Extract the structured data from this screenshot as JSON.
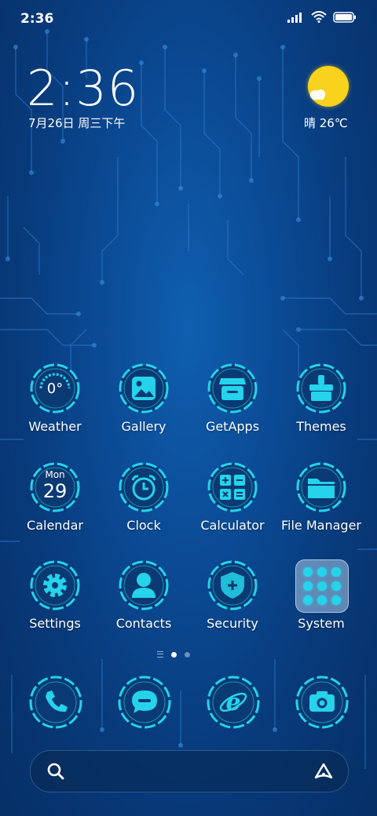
{
  "status_bar": {
    "time": "2:36"
  },
  "widget": {
    "time": "2:36",
    "date": "7月26日 周三下午",
    "weather": "晴 26℃"
  },
  "apps": [
    {
      "label": "Weather",
      "icon": "weather-icon",
      "glyph_text": "0°"
    },
    {
      "label": "Gallery",
      "icon": "gallery-icon"
    },
    {
      "label": "GetApps",
      "icon": "getapps-icon"
    },
    {
      "label": "Themes",
      "icon": "themes-icon"
    },
    {
      "label": "Calendar",
      "icon": "calendar-icon",
      "day_name": "Mon",
      "day_num": "29"
    },
    {
      "label": "Clock",
      "icon": "clock-icon"
    },
    {
      "label": "Calculator",
      "icon": "calculator-icon"
    },
    {
      "label": "File Manager",
      "icon": "folder-icon"
    },
    {
      "label": "Settings",
      "icon": "gear-icon"
    },
    {
      "label": "Contacts",
      "icon": "contact-icon"
    },
    {
      "label": "Security",
      "icon": "shield-icon"
    },
    {
      "label": "System",
      "icon": "folder-group-icon"
    }
  ],
  "pager": {
    "pages": 2,
    "active": 1
  },
  "dock": [
    {
      "icon": "phone-icon"
    },
    {
      "icon": "message-icon"
    },
    {
      "icon": "browser-icon"
    },
    {
      "icon": "camera-icon"
    }
  ],
  "colors": {
    "accent": "#25d3ea",
    "sun": "#f8d21c",
    "background": "#0b4a94"
  }
}
